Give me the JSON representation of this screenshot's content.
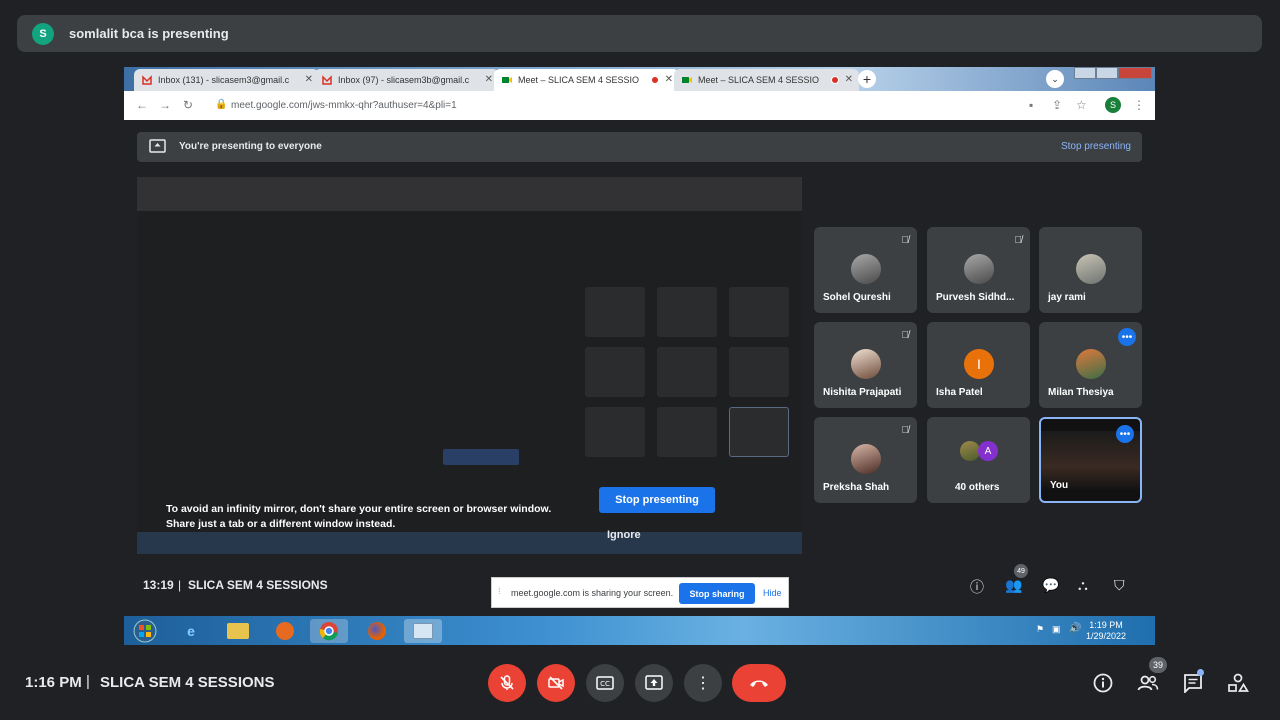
{
  "presenter_bar": {
    "avatar": "S",
    "text": "somlalit bca is presenting"
  },
  "browser": {
    "tabs": [
      {
        "label": "Inbox (131) - slicasem3@gmail.c",
        "icon": "gmail-icon"
      },
      {
        "label": "Inbox (97) - slicasem3b@gmail.c",
        "icon": "gmail-icon"
      },
      {
        "label": "Meet – SLICA SEM 4 SESSIO",
        "icon": "meet-icon"
      },
      {
        "label": "Meet – SLICA SEM 4 SESSIO",
        "icon": "meet-icon"
      }
    ],
    "url": "meet.google.com/jws-mmkx-qhr?authuser=4&pli=1",
    "profile_initial": "S"
  },
  "present_banner": {
    "text": "You're presenting to everyone",
    "stop": "Stop presenting"
  },
  "mirror_warning": {
    "line1": "To avoid an infinity mirror, don't share your entire screen or browser window.",
    "line2": "Share just a tab or a different window instead.",
    "stop_button": "Stop presenting",
    "ignore": "Ignore"
  },
  "participants": [
    {
      "name": "Sohel Qureshi",
      "muted": true
    },
    {
      "name": "Purvesh Sidhd...",
      "muted": true
    },
    {
      "name": "jay rami",
      "muted": false
    },
    {
      "name": "Nishita Prajapati",
      "muted": true
    },
    {
      "name": "Isha Patel",
      "initial": "I",
      "muted": false
    },
    {
      "name": "Milan Thesiya",
      "muted": false
    },
    {
      "name": "Preksha Shah",
      "muted": true
    },
    {
      "name": "40 others",
      "initial": "A"
    },
    {
      "name": "You"
    }
  ],
  "inner_meet_bar": {
    "time": "13:19",
    "meeting": "SLICA SEM 4 SESSIONS",
    "people_count": "49"
  },
  "share_popup": {
    "text": "meet.google.com is sharing your screen.",
    "stop": "Stop sharing",
    "hide": "Hide"
  },
  "taskbar": {
    "time": "1:19 PM",
    "date": "1/29/2022"
  },
  "bottom_bar": {
    "time": "1:16 PM",
    "meeting": "SLICA SEM 4 SESSIONS",
    "people_count": "39"
  },
  "colors": {
    "accent": "#1a73e8",
    "danger": "#ea4335",
    "surface": "#3c4043",
    "background": "#202124"
  }
}
